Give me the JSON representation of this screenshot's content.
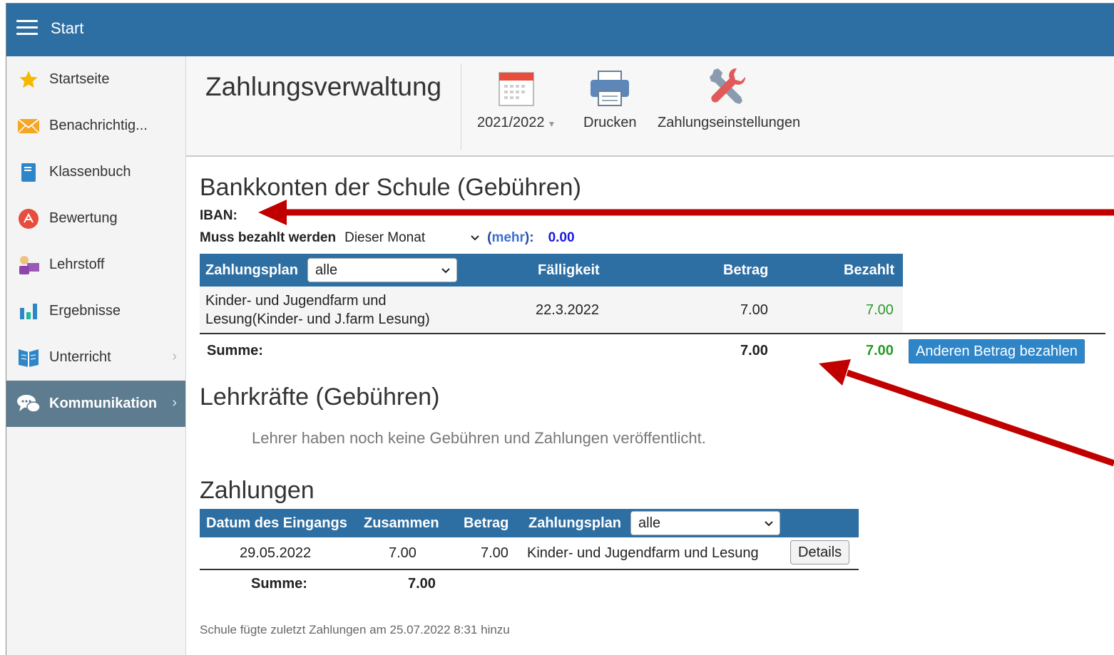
{
  "topbar": {
    "title": "Start"
  },
  "sidebar": {
    "items": [
      {
        "label": "Startseite",
        "icon": "star-icon"
      },
      {
        "label": "Benachrichtig...",
        "icon": "envelope-icon"
      },
      {
        "label": "Klassenbuch",
        "icon": "book-icon"
      },
      {
        "label": "Bewertung",
        "icon": "grade-icon"
      },
      {
        "label": "Lehrstoff",
        "icon": "teacher-icon"
      },
      {
        "label": "Ergebnisse",
        "icon": "bar-chart-icon"
      },
      {
        "label": "Unterricht",
        "icon": "open-book-icon"
      },
      {
        "label": "Kommunikation",
        "icon": "chat-icon"
      }
    ],
    "active": "Kommunikation"
  },
  "toolbar": {
    "title": "Zahlungsverwaltung",
    "year": "2021/2022",
    "print": "Drucken",
    "settings": "Zahlungseinstellungen"
  },
  "bank": {
    "heading": "Bankkonten der Schule (Gebühren)",
    "iban_label": "IBAN:",
    "must_pay_label": "Muss bezahlt werden",
    "month_select": "Dieser Monat",
    "more_prefix": "(",
    "more_link": "mehr",
    "more_suffix": "):",
    "must_pay_value": "0.00",
    "columns": {
      "plan": "Zahlungsplan",
      "plan_filter": "alle",
      "due": "Fälligkeit",
      "amount": "Betrag",
      "paid": "Bezahlt"
    },
    "rows": [
      {
        "name_line1": "Kinder- und Jugendfarm und",
        "name_line2": "Lesung(Kinder- und J.farm Lesung)",
        "due": "22.3.2022",
        "amount": "7.00",
        "paid": "7.00"
      }
    ],
    "sum_label": "Summe:",
    "sum_amount": "7.00",
    "sum_paid": "7.00",
    "pay_other_button": "Anderen Betrag bezahlen"
  },
  "teachers": {
    "heading": "Lehrkräfte (Gebühren)",
    "empty_text": "Lehrer haben noch keine Gebühren und Zahlungen veröffentlicht."
  },
  "payments": {
    "heading": "Zahlungen",
    "columns": {
      "date": "Datum des Eingangs",
      "total": "Zusammen",
      "amount": "Betrag",
      "plan": "Zahlungsplan",
      "plan_filter": "alle"
    },
    "rows": [
      {
        "date": "29.05.2022",
        "total": "7.00",
        "amount": "7.00",
        "plan": "Kinder- und Jugendfarm und Lesung",
        "details": "Details"
      }
    ],
    "sum_label": "Summe:",
    "sum_total": "7.00",
    "footer": "Schule fügte zuletzt Zahlungen am 25.07.2022 8:31 hinzu"
  },
  "colors": {
    "header_blue": "#2e6fa3",
    "active_nav": "#5e7c8f",
    "paid_green": "#2a9a2a",
    "value_blue": "#1919e0",
    "annotation_red": "#c00000"
  }
}
